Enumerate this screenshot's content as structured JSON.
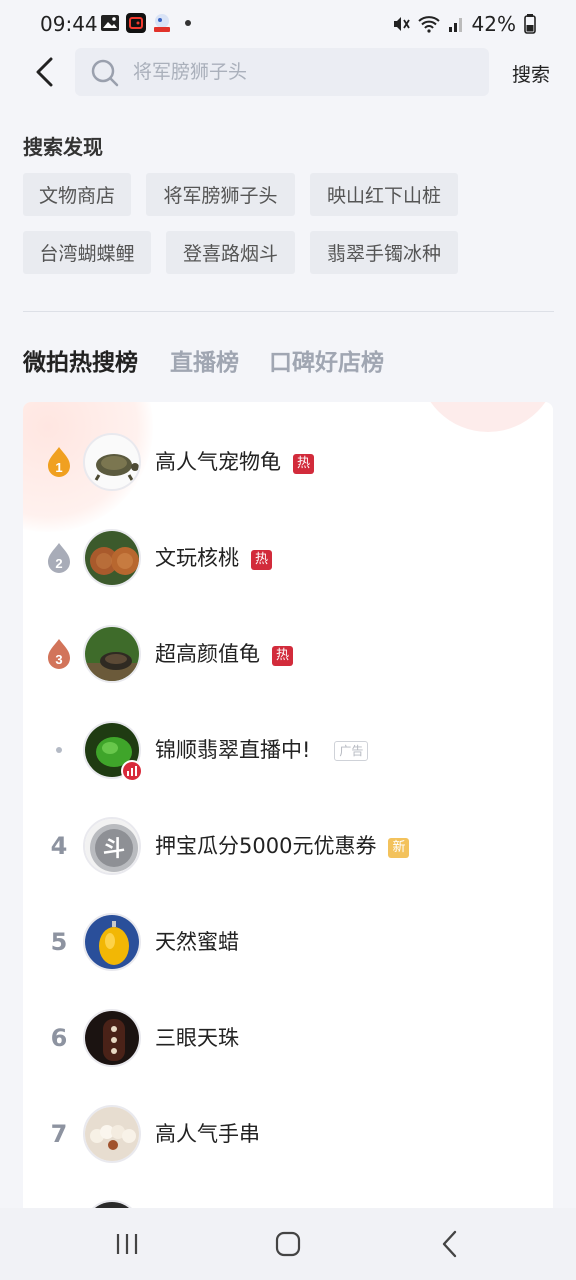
{
  "status": {
    "time": "09:44",
    "battery": "42%"
  },
  "header": {
    "search_placeholder": "将军膀狮子头",
    "search_button": "搜索"
  },
  "discover": {
    "title": "搜索发现",
    "chips": [
      "文物商店",
      "将军膀狮子头",
      "映山红下山桩",
      "台湾蝴蝶鲤",
      "登喜路烟斗",
      "翡翠手镯冰种"
    ]
  },
  "tabs": [
    "微拍热搜榜",
    "直播榜",
    "口碑好店榜"
  ],
  "ranking": [
    {
      "rank": "1",
      "title": "高人气宠物龟",
      "badge": "热"
    },
    {
      "rank": "2",
      "title": "文玩核桃",
      "badge": "热"
    },
    {
      "rank": "3",
      "title": "超高颜值龟",
      "badge": "热"
    },
    {
      "rank": "",
      "title": "锦顺翡翠直播中!",
      "badge": "广告"
    },
    {
      "rank": "4",
      "title": "押宝瓜分5000元优惠券",
      "badge": "新"
    },
    {
      "rank": "5",
      "title": "天然蜜蜡",
      "badge": ""
    },
    {
      "rank": "6",
      "title": "三眼天珠",
      "badge": ""
    },
    {
      "rank": "7",
      "title": "高人气手串",
      "badge": ""
    }
  ],
  "colors": {
    "hot_badge": "#d22b3b",
    "new_badge": "#f3c25c",
    "medal_gold": "#f0a020",
    "medal_silver": "#a8acb8",
    "medal_bronze": "#d2745a"
  }
}
